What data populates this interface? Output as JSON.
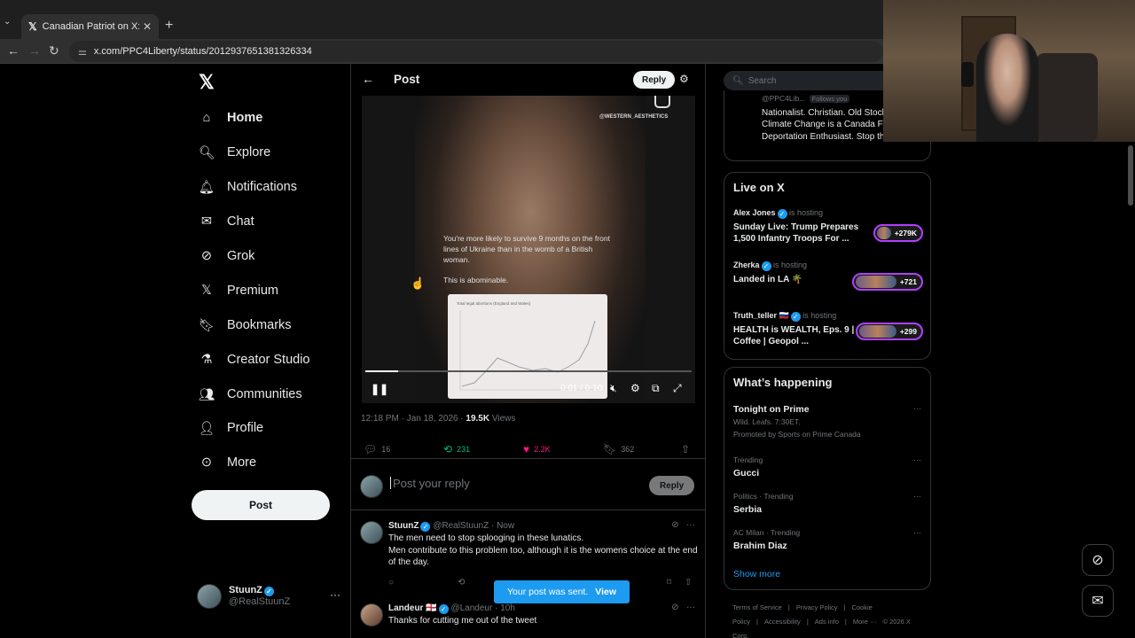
{
  "browser": {
    "tab_title": "Canadian Patriot on X: \"https://",
    "url": "x.com/PPC4Liberty/status/2012937651381326334"
  },
  "nav": {
    "items": [
      {
        "label": "Home",
        "icon": "home-icon"
      },
      {
        "label": "Explore",
        "icon": "search-icon"
      },
      {
        "label": "Notifications",
        "icon": "bell-icon"
      },
      {
        "label": "Chat",
        "icon": "mail-icon"
      },
      {
        "label": "Grok",
        "icon": "grok-icon"
      },
      {
        "label": "Premium",
        "icon": "x-icon"
      },
      {
        "label": "Bookmarks",
        "icon": "bookmark-icon"
      },
      {
        "label": "Creator Studio",
        "icon": "flask-icon"
      },
      {
        "label": "Communities",
        "icon": "people-icon"
      },
      {
        "label": "Profile",
        "icon": "person-icon"
      },
      {
        "label": "More",
        "icon": "more-circle-icon"
      }
    ],
    "post_label": "Post",
    "user_name": "StuunZ",
    "user_handle": "@RealStuunZ"
  },
  "header": {
    "title": "Post",
    "reply_label": "Reply"
  },
  "video": {
    "watermark": "@WESTERN_AESTHETICS",
    "overlay_text": "You're more likely to survive 9 months on the front lines of Ukraine than in the womb of a British woman.",
    "overlay_text2": "This is abominable.",
    "chart_title": "Total legal abortions (England and Wales)",
    "time": "0:01 / 0:10",
    "progress": 0.1
  },
  "post_meta": {
    "time": "12:18 PM · Jan 18, 2026 · ",
    "views": "19.5K",
    "views_label": " Views"
  },
  "actions": {
    "replies": "16",
    "reposts": "231",
    "likes": "2.2K",
    "bookmarks": "362"
  },
  "compose": {
    "placeholder": "Post your reply",
    "reply_label": "Reply"
  },
  "tweets": [
    {
      "name": "StuunZ",
      "handle": "@RealStuunZ · Now",
      "body1": "The men need to stop splooging in these lunatics.",
      "body2": "Men contribute to this problem too, although it is the womens choice at the end of the day."
    },
    {
      "name": "Landeur",
      "flag": "🏴󠁧󠁢󠁥󠁮󠁧󠁿",
      "handle": "@Landeur · 10h",
      "body1": "Thanks for cutting me out of the tweet"
    }
  ],
  "toast": {
    "text": "Your post was sent.",
    "action": "View"
  },
  "right": {
    "search_placeholder": "Search",
    "bio_handle": "@PPC4Lib...",
    "follows_you": "Follows you",
    "bio": "Nationalist. Christian. Old Stock Canadian. Climate Change is a Canada First. Mass Deportation Enthusiast. Stop the Invasion.",
    "live_title": "Live on X",
    "live": [
      {
        "host": "Alex Jones",
        "hosting": " is hosting",
        "title": "Sunday Live: Trump Prepares 1,500 Infantry Troops For ...",
        "count": "+279K"
      },
      {
        "host": "Zherka",
        "hosting": " is hosting",
        "title": "Landed in LA 🌴",
        "count": "+721"
      },
      {
        "host": "Truth_teller 🇷🇺",
        "hosting": " is hosting",
        "title": "HEALTH is WEALTH, Eps. 9 | Coffee | Geopol ...",
        "count": "+299"
      }
    ],
    "happening_title": "What’s happening",
    "trends": [
      {
        "ctx": "",
        "title": "Tonight on Prime",
        "sub": "Wild. Leafs. 7:30ET.",
        "promo": "Promoted by Sports on Prime Canada"
      },
      {
        "ctx": "Trending",
        "title": "Gucci"
      },
      {
        "ctx": "Politics · Trending",
        "title": "Serbia"
      },
      {
        "ctx": "AC Milan · Trending",
        "title": "Brahim Diaz"
      }
    ],
    "show_more": "Show more",
    "footer": [
      "Terms of Service",
      "|",
      "Privacy Policy",
      "|",
      "Cookie Policy",
      "|",
      "Accessibility",
      "|",
      "Ads info",
      "|",
      "More ···",
      "© 2026 X Corp."
    ]
  },
  "colors": {
    "accent": "#1d9bf0",
    "repost": "#00ba7c",
    "like": "#f91880",
    "live_ring": "#b140ff"
  }
}
